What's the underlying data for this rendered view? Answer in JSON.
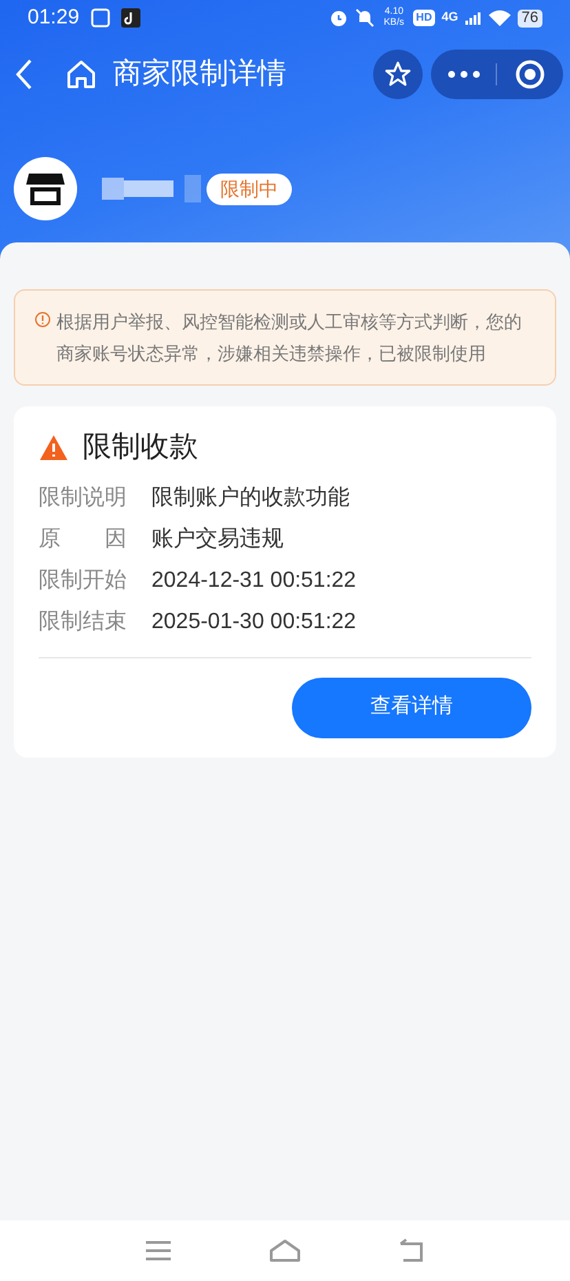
{
  "status_bar": {
    "time": "01:29",
    "speed": "4.10 KB/s",
    "hd": "HD",
    "network": "4G",
    "battery": "76"
  },
  "nav": {
    "title": "商家限制详情"
  },
  "merchant": {
    "badge": "限制中"
  },
  "notice": {
    "text": "根据用户举报、风控智能检测或人工审核等方式判断，您的商家账号状态异常，涉嫌相关违禁操作，已被限制使用"
  },
  "restriction": {
    "title": "限制收款",
    "rows": [
      {
        "label": "限制说明",
        "value": "限制账户的收款功能"
      },
      {
        "label": "原　　因",
        "value": "账户交易违规"
      },
      {
        "label": "限制开始",
        "value": "2024-12-31 00:51:22"
      },
      {
        "label": "限制结束",
        "value": "2025-01-30 00:51:22"
      }
    ],
    "button": "查看详情"
  }
}
